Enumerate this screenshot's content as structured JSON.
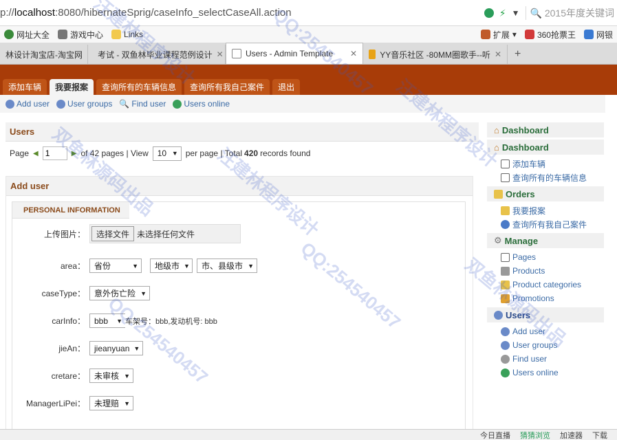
{
  "browser": {
    "url_prefix": "p://",
    "url_host": "localhost",
    "url_path": ":8080/hibernateSprig/caseInfo_selectCaseAll.action",
    "search_placeholder": "2015年度关键词",
    "bookmarks": [
      "网址大全",
      "游戏中心",
      "Links"
    ],
    "bookmarks_right": [
      "扩展",
      "360抢票王",
      "网银"
    ],
    "tabs": [
      {
        "label": "林设计淘宝店-淘宝网"
      },
      {
        "label": "考试 - 双鱼林毕业课程范例设计"
      },
      {
        "label": "Users - Admin Template"
      },
      {
        "label": "YY音乐社区 -80MM圈歌手--听"
      }
    ],
    "status_items": [
      "今日直播",
      "猜猜浏览",
      "加速器",
      "下载"
    ]
  },
  "nav": {
    "items": [
      "添加车辆",
      "我要报案",
      "查询所有的车辆信息",
      "查询所有我自己案件",
      "退出"
    ]
  },
  "toolbar": {
    "items": [
      "Add user",
      "User groups",
      "Find user",
      "Users online"
    ]
  },
  "users_panel": {
    "title": "Users",
    "page_label": "Page",
    "page_value": "1",
    "of_pages": "of 42 pages | View",
    "view_value": "10",
    "per_page": "per page | Total",
    "total": "420",
    "records_found": "records found"
  },
  "add_user": {
    "title": "Add user",
    "legend": "PERSONAL INFORMATION",
    "upload_label": "上传图片：",
    "file_button": "选择文件",
    "file_status": "未选择任何文件",
    "area_label": "area：",
    "province": "省份",
    "city": "地级市",
    "county": "市、县级市",
    "casetype_label": "caseType：",
    "casetype_value": "意外伤亡险",
    "carinfo_label": "carInfo：",
    "carinfo_value": "bbb",
    "carinfo_text": "车架号：bbb,发动机号: bbb",
    "jiean_label": "jieAn：",
    "jiean_value": "jieanyuan",
    "cretare_label": "cretare：",
    "cretare_value": "未审核",
    "lipei_label": "ManagerLiPei：",
    "lipei_value": "未理赔"
  },
  "sidebar": {
    "dashboard1": "Dashboard",
    "dashboard2": "Dashboard",
    "dash_items": [
      "添加车辆",
      "查询所有的车辆信息"
    ],
    "orders": "Orders",
    "order_items": [
      "我要报案",
      "查询所有我自己案件"
    ],
    "manage": "Manage",
    "manage_items": [
      "Pages",
      "Products",
      "Product categories",
      "Promotions"
    ],
    "users": "Users",
    "user_items": [
      "Add user",
      "User groups",
      "Find user",
      "Users online"
    ]
  },
  "watermarks": [
    "汪建林程序设计",
    "QQ:254540457",
    "双鱼林源码出品"
  ],
  "colors": {
    "header": "#a83c08",
    "nav_tab": "#bf5417",
    "link": "#3a6aa5",
    "heading": "#8a4a1a"
  }
}
